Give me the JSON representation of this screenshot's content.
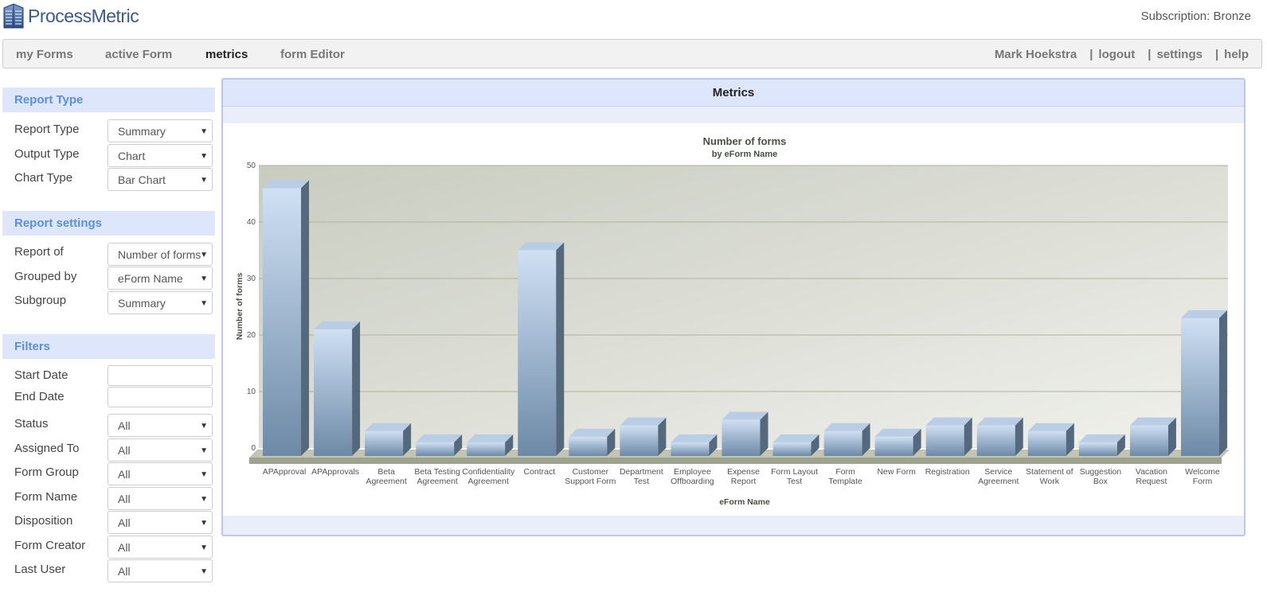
{
  "header": {
    "brand": "ProcessMetric",
    "subscription": "Subscription: Bronze"
  },
  "nav": {
    "items": [
      "my Forms",
      "active Form",
      "metrics",
      "form Editor"
    ],
    "active": "metrics",
    "user": "Mark Hoekstra",
    "separator": "|",
    "logout": "logout",
    "settings": "settings",
    "help": "help"
  },
  "sidebar": {
    "report_type": {
      "title": "Report Type",
      "fields": [
        {
          "label": "Report Type",
          "value": "Summary"
        },
        {
          "label": "Output Type",
          "value": "Chart"
        },
        {
          "label": "Chart Type",
          "value": "Bar Chart"
        }
      ]
    },
    "report_settings": {
      "title": "Report settings",
      "fields": [
        {
          "label": "Report of",
          "value": "Number of forms"
        },
        {
          "label": "Grouped by",
          "value": "eForm Name"
        },
        {
          "label": "Subgroup",
          "value": "Summary"
        }
      ]
    },
    "filters": {
      "title": "Filters",
      "start_date": {
        "label": "Start Date",
        "value": ""
      },
      "end_date": {
        "label": "End Date",
        "value": ""
      },
      "fields": [
        {
          "label": "Status",
          "value": "All"
        },
        {
          "label": "Assigned To",
          "value": "All"
        },
        {
          "label": "Form Group",
          "value": "All"
        },
        {
          "label": "Form Name",
          "value": "All"
        },
        {
          "label": "Disposition",
          "value": "All"
        },
        {
          "label": "Form Creator",
          "value": "All"
        },
        {
          "label": "Last User",
          "value": "All"
        }
      ]
    }
  },
  "panel": {
    "title": "Metrics"
  },
  "colors": {
    "bar_face_top": "#cfe0f4",
    "bar_face_bottom": "#6d89a6",
    "bar_side": "#55697e",
    "bar_top": "#b9cde4",
    "plot_bg": "#d8dbd0",
    "floor": "#9ea38d",
    "section_head": "#dde6fa",
    "section_text": "#5b8fe0"
  },
  "chart_data": {
    "type": "bar",
    "title": "Number of forms",
    "subtitle": "by eForm Name",
    "xlabel": "eForm Name",
    "ylabel": "Number of forms",
    "ylim": [
      0,
      50
    ],
    "yticks": [
      0,
      10,
      20,
      30,
      40,
      50
    ],
    "grid": true,
    "style": "3d",
    "categories": [
      [
        "APApproval"
      ],
      [
        "APApprovals"
      ],
      [
        "Beta",
        "Agreement"
      ],
      [
        "Beta Testing",
        "Agreement"
      ],
      [
        "Confidentiality",
        "Agreement"
      ],
      [
        "Contract"
      ],
      [
        "Customer",
        "Support Form"
      ],
      [
        "Department",
        "Test"
      ],
      [
        "Employee",
        "Offboarding"
      ],
      [
        "Expense",
        "Report"
      ],
      [
        "Form Layout",
        "Test"
      ],
      [
        "Form",
        "Template"
      ],
      [
        "New Form"
      ],
      [
        "Registration"
      ],
      [
        "Service",
        "Agreement"
      ],
      [
        "Statement of",
        "Work"
      ],
      [
        "Suggestion",
        "Box"
      ],
      [
        "Vacation",
        "Request"
      ],
      [
        "Welcome",
        "Form"
      ]
    ],
    "values": [
      46,
      21,
      3,
      1,
      1,
      35,
      2,
      4,
      1,
      5,
      1,
      3,
      2,
      4,
      4,
      3,
      1,
      4,
      23
    ]
  }
}
